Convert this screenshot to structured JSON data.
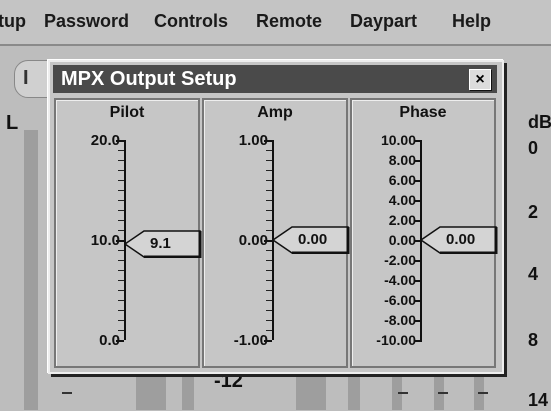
{
  "menu": [
    "tup",
    "Password",
    "Controls",
    "Remote",
    "Daypart",
    "Help"
  ],
  "background": {
    "chip_label": "I",
    "left_label": "L",
    "unit_label": "dB",
    "scale": [
      "0",
      "2",
      "4",
      "8",
      "14"
    ],
    "bottom_label": "-12"
  },
  "dialog": {
    "title": "MPX Output Setup",
    "close_glyph": "×",
    "panels": [
      {
        "title": "Pilot",
        "labels": [
          "20.0",
          "10.0",
          "0.0"
        ],
        "value": "9.1"
      },
      {
        "title": "Amp",
        "labels": [
          "1.00",
          "0.00",
          "-1.00"
        ],
        "value": "0.00"
      },
      {
        "title": "Phase",
        "labels": [
          "10.00",
          "8.00",
          "6.00",
          "4.00",
          "2.00",
          "0.00",
          "-2.00",
          "-4.00",
          "-6.00",
          "-8.00",
          "-10.00"
        ],
        "value": "0.00"
      }
    ]
  }
}
